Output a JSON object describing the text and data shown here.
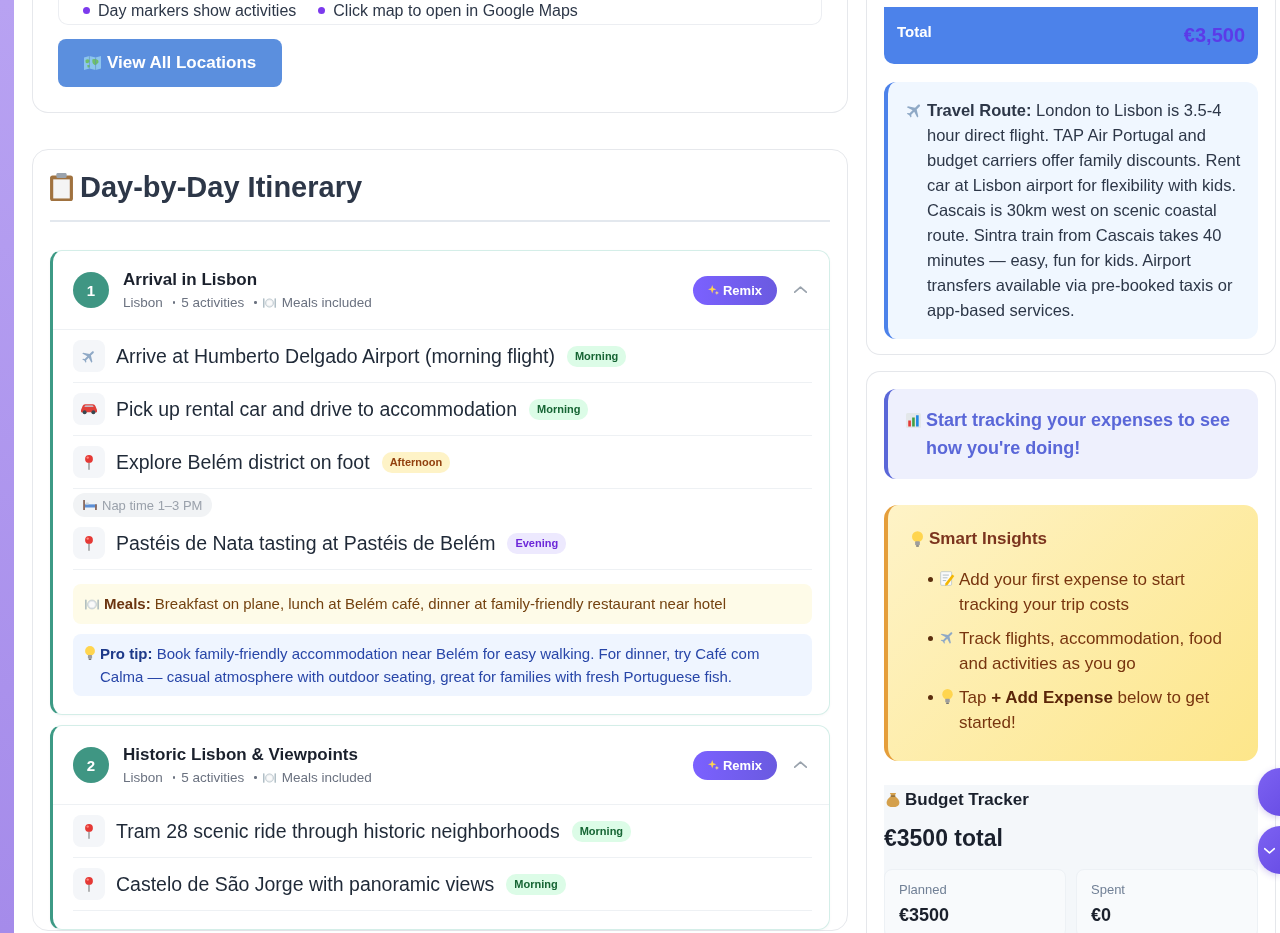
{
  "locations_card": {
    "legend": [
      "Day markers show activities",
      "Click map to open in Google Maps"
    ],
    "button": "View All Locations"
  },
  "itinerary": {
    "title": "Day-by-Day Itinerary",
    "days": [
      {
        "number": "1",
        "title": "Arrival in Lisbon",
        "location": "Lisbon",
        "activity_count": "5 activities",
        "meals": "Meals included",
        "remix": "Remix",
        "expanded": true,
        "activities": [
          {
            "kind": "flight",
            "text": "Arrive at Humberto Delgado Airport (morning flight)",
            "time": {
              "label": "Morning",
              "kind": "morning"
            }
          },
          {
            "kind": "car",
            "text": "Pick up rental car and drive to accommodation",
            "time": {
              "label": "Morning",
              "kind": "morning"
            }
          },
          {
            "kind": "place",
            "text": "Explore Belém district on foot",
            "time": {
              "label": "Afternoon",
              "kind": "afternoon"
            }
          },
          {
            "kind": "rest",
            "text": "Nap time 1–3 PM"
          },
          {
            "kind": "place",
            "text": "Pastéis de Nata tasting at Pastéis de Belém",
            "time": {
              "label": "Evening",
              "kind": "evening"
            }
          }
        ],
        "meals_note": "**Meals:** Breakfast on plane, lunch at Belém café, dinner at family-friendly restaurant near hotel",
        "tip": "**Pro tip:** Book family-friendly accommodation near Belém for easy walking. For dinner, try Café com Calma — casual atmosphere with outdoor seating, great for families with fresh Portuguese fish."
      },
      {
        "number": "2",
        "title": "Historic Lisbon & Viewpoints",
        "location": "Lisbon",
        "activity_count": "5 activities",
        "meals": "Meals included",
        "remix": "Remix",
        "expanded": true,
        "activities": [
          {
            "kind": "place",
            "text": "Tram 28 scenic ride through historic neighborhoods",
            "time": {
              "label": "Morning",
              "kind": "morning"
            }
          },
          {
            "kind": "place",
            "text": "Castelo de São Jorge with panoramic views",
            "time": {
              "label": "Morning",
              "kind": "morning"
            }
          }
        ]
      }
    ]
  },
  "cost_summary": {
    "total_label": "Total",
    "total_value": "€3,500",
    "travel_route": "**Travel Route:** London to Lisbon is 3.5-4 hour direct flight. TAP Air Portugal and budget carriers offer family discounts. Rent car at Lisbon airport for flexibility with kids. Cascais is 30km west on scenic coastal route. Sintra train from Cascais takes 40 minutes — easy, fun for kids. Airport transfers available via pre-booked taxis or app-based services."
  },
  "expenses": {
    "prompt": "Start tracking your expenses to see how you're doing!",
    "insights": {
      "title": "Smart Insights",
      "items": [
        {
          "kind": "note",
          "text": "Add your first expense to start tracking your trip costs"
        },
        {
          "kind": "flight",
          "text": "Track flights, accommodation, food and activities as you go"
        },
        {
          "kind": "tip",
          "text": "Tap **+ Add Expense** below to get started!"
        }
      ]
    },
    "budget": {
      "title": "Budget Tracker",
      "total": "€3500 total",
      "stats": [
        {
          "label": "Planned",
          "value": "€3500"
        },
        {
          "label": "Spent",
          "value": "€0"
        }
      ]
    }
  },
  "floating_buttons": [
    {
      "kind": "plain"
    },
    {
      "kind": "chevron"
    }
  ]
}
